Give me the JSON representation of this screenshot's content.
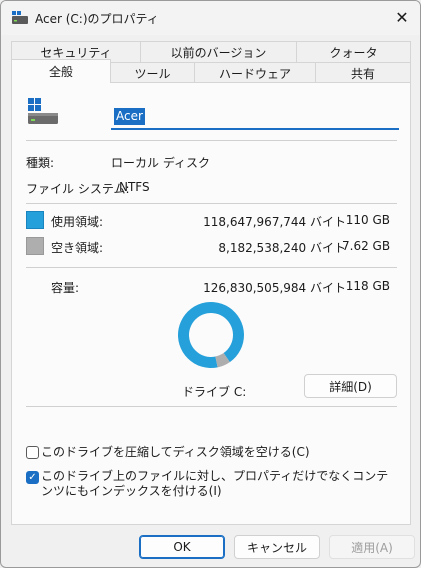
{
  "window": {
    "title": "Acer (C:)のプロパティ",
    "close_symbol": "✕"
  },
  "tabs": {
    "row1": [
      "セキュリティ",
      "以前のバージョン",
      "クォータ"
    ],
    "row2": [
      "全般",
      "ツール",
      "ハードウェア",
      "共有"
    ],
    "selected": "全般"
  },
  "drive": {
    "name": "Acer"
  },
  "info": {
    "type_label": "種類:",
    "type_value": "ローカル ディスク",
    "fs_label": "ファイル システム:",
    "fs_value": "NTFS"
  },
  "space": {
    "used_label": "使用領域:",
    "used_bytes": "118,647,967,744 バイト",
    "used_gb": "110 GB",
    "free_label": "空き領域:",
    "free_bytes": "8,182,538,240 バイト",
    "free_gb": "7.62 GB",
    "capacity_label": "容量:",
    "capacity_bytes": "126,830,505,984 バイト",
    "capacity_gb": "118 GB"
  },
  "chart_data": {
    "type": "pie",
    "categories": [
      "使用領域",
      "空き領域"
    ],
    "values": [
      118647967744,
      8182538240
    ],
    "colors": [
      "#26a0da",
      "#aeaeae"
    ]
  },
  "drive_label": "ドライブ C:",
  "details_button": "詳細(D)",
  "options": {
    "compress_label": "このドライブを圧縮してディスク領域を空ける(C)",
    "compress_checked": false,
    "index_label": "このドライブ上のファイルに対し、プロパティだけでなくコンテンツにもインデックスを付ける(I)",
    "index_checked": true,
    "check_mark": "✓"
  },
  "footer": {
    "ok": "OK",
    "cancel": "キャンセル",
    "apply": "適用(A)"
  },
  "colors": {
    "accent": "#1a6fc4",
    "used": "#26a0da",
    "free": "#aeaeae"
  }
}
